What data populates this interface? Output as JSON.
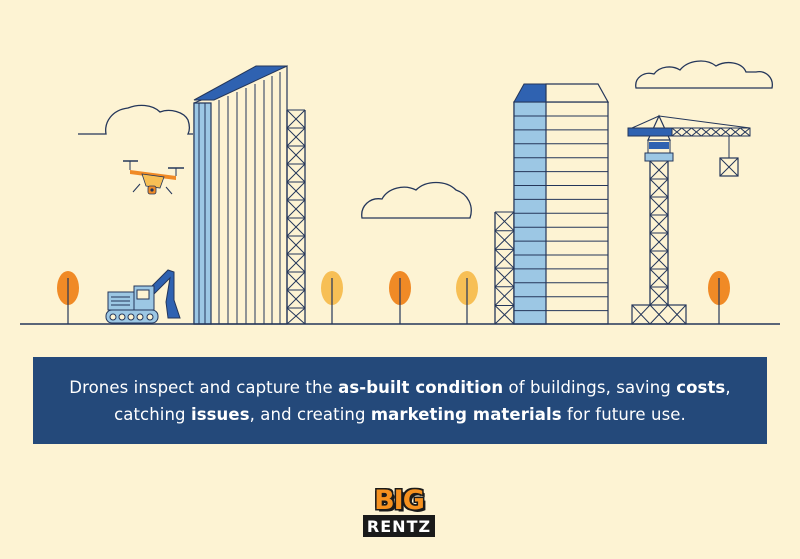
{
  "caption": {
    "line1": {
      "t1": "Drones inspect and capture the ",
      "b1": "as-built condition",
      "t2": " of buildings, saving ",
      "b2": "costs",
      "t3": ","
    },
    "line2": {
      "t1": "catching ",
      "b1": "issues",
      "t2": ", and creating ",
      "b2": "marketing materials",
      "t3": " for future use."
    }
  },
  "logo": {
    "top": "BIG",
    "bottom": "RENTZ"
  },
  "colors": {
    "background": "#fdf3d3",
    "banner": "#24497a",
    "line": "#24365a",
    "building_light": "#9cc7e4",
    "building_dark": "#2f62b1",
    "tree_orange": "#f08a26",
    "tree_light": "#f7bf55",
    "logo_orange": "#f5911f"
  },
  "icons": [
    "drone-icon",
    "excavator-icon",
    "crane-icon",
    "tree-icon",
    "cloud-icon"
  ]
}
